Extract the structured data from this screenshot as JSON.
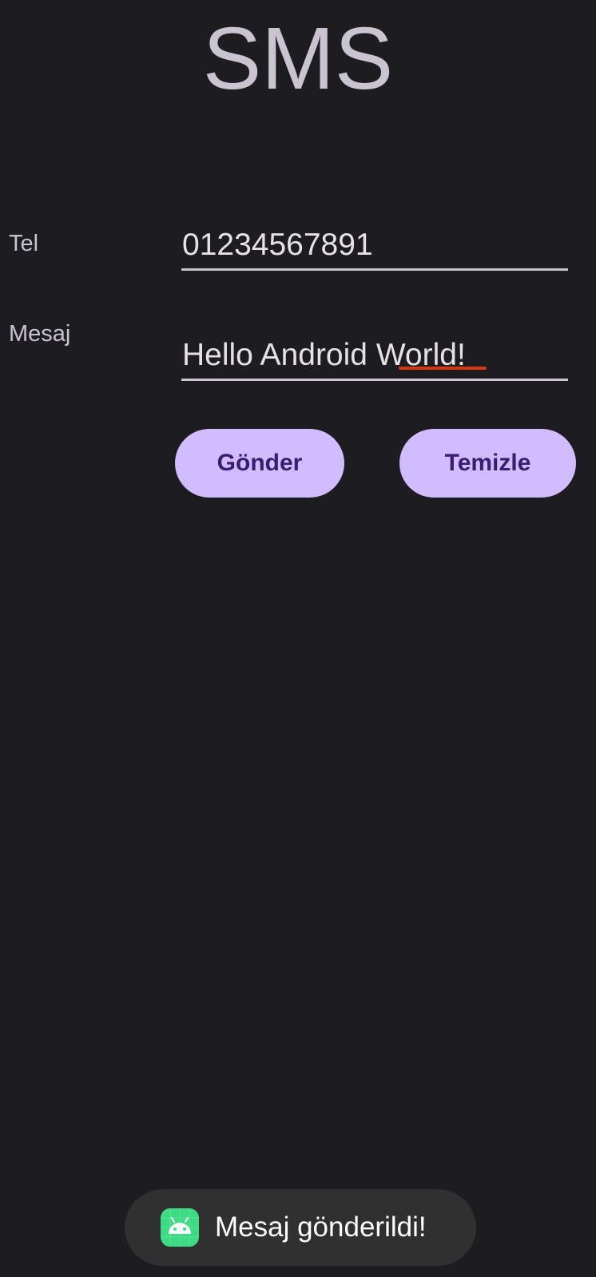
{
  "app": {
    "title": "SMS"
  },
  "form": {
    "tel_label": "Tel",
    "tel_value": "01234567891",
    "message_label": "Mesaj",
    "message_value": "Hello Android World!"
  },
  "buttons": {
    "send_label": "Gönder",
    "clear_label": "Temizle"
  },
  "toast": {
    "icon": "android-app-icon",
    "message": "Mesaj gönderildi!"
  },
  "colors": {
    "background": "#1d1c21",
    "button": "#d0bcff",
    "button_text": "#381e72",
    "spellcheck": "#d8360b",
    "toast": "#303030",
    "icon": "#3ddc84"
  }
}
